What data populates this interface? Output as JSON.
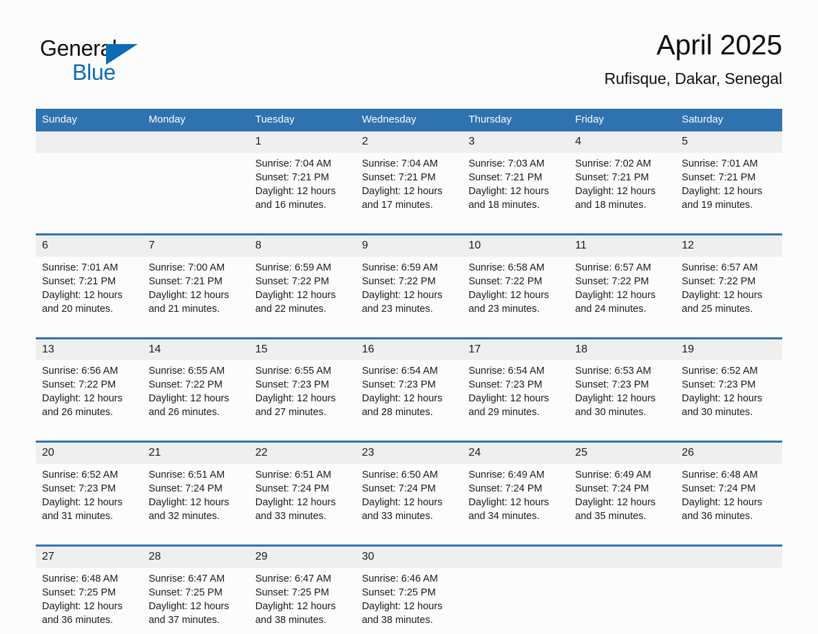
{
  "brand": {
    "word_one": "General",
    "word_two": "Blue",
    "triangle_icon": "triangle-icon"
  },
  "header": {
    "month_title": "April 2025",
    "location": "Rufisque, Dakar, Senegal"
  },
  "colors": {
    "header_blue": "#2f72b0",
    "brand_blue": "#0b6bb5",
    "daynum_band": "#efefef",
    "page_background": "#fcfcfd",
    "text": "#1a1a1a"
  },
  "calendar": {
    "weekdays": [
      "Sunday",
      "Monday",
      "Tuesday",
      "Wednesday",
      "Thursday",
      "Friday",
      "Saturday"
    ],
    "weeks": [
      [
        {
          "day": "",
          "lines": []
        },
        {
          "day": "",
          "lines": []
        },
        {
          "day": "1",
          "lines": [
            "Sunrise: 7:04 AM",
            "Sunset: 7:21 PM",
            "Daylight: 12 hours",
            "and 16 minutes."
          ]
        },
        {
          "day": "2",
          "lines": [
            "Sunrise: 7:04 AM",
            "Sunset: 7:21 PM",
            "Daylight: 12 hours",
            "and 17 minutes."
          ]
        },
        {
          "day": "3",
          "lines": [
            "Sunrise: 7:03 AM",
            "Sunset: 7:21 PM",
            "Daylight: 12 hours",
            "and 18 minutes."
          ]
        },
        {
          "day": "4",
          "lines": [
            "Sunrise: 7:02 AM",
            "Sunset: 7:21 PM",
            "Daylight: 12 hours",
            "and 18 minutes."
          ]
        },
        {
          "day": "5",
          "lines": [
            "Sunrise: 7:01 AM",
            "Sunset: 7:21 PM",
            "Daylight: 12 hours",
            "and 19 minutes."
          ]
        }
      ],
      [
        {
          "day": "6",
          "lines": [
            "Sunrise: 7:01 AM",
            "Sunset: 7:21 PM",
            "Daylight: 12 hours",
            "and 20 minutes."
          ]
        },
        {
          "day": "7",
          "lines": [
            "Sunrise: 7:00 AM",
            "Sunset: 7:21 PM",
            "Daylight: 12 hours",
            "and 21 minutes."
          ]
        },
        {
          "day": "8",
          "lines": [
            "Sunrise: 6:59 AM",
            "Sunset: 7:22 PM",
            "Daylight: 12 hours",
            "and 22 minutes."
          ]
        },
        {
          "day": "9",
          "lines": [
            "Sunrise: 6:59 AM",
            "Sunset: 7:22 PM",
            "Daylight: 12 hours",
            "and 23 minutes."
          ]
        },
        {
          "day": "10",
          "lines": [
            "Sunrise: 6:58 AM",
            "Sunset: 7:22 PM",
            "Daylight: 12 hours",
            "and 23 minutes."
          ]
        },
        {
          "day": "11",
          "lines": [
            "Sunrise: 6:57 AM",
            "Sunset: 7:22 PM",
            "Daylight: 12 hours",
            "and 24 minutes."
          ]
        },
        {
          "day": "12",
          "lines": [
            "Sunrise: 6:57 AM",
            "Sunset: 7:22 PM",
            "Daylight: 12 hours",
            "and 25 minutes."
          ]
        }
      ],
      [
        {
          "day": "13",
          "lines": [
            "Sunrise: 6:56 AM",
            "Sunset: 7:22 PM",
            "Daylight: 12 hours",
            "and 26 minutes."
          ]
        },
        {
          "day": "14",
          "lines": [
            "Sunrise: 6:55 AM",
            "Sunset: 7:22 PM",
            "Daylight: 12 hours",
            "and 26 minutes."
          ]
        },
        {
          "day": "15",
          "lines": [
            "Sunrise: 6:55 AM",
            "Sunset: 7:23 PM",
            "Daylight: 12 hours",
            "and 27 minutes."
          ]
        },
        {
          "day": "16",
          "lines": [
            "Sunrise: 6:54 AM",
            "Sunset: 7:23 PM",
            "Daylight: 12 hours",
            "and 28 minutes."
          ]
        },
        {
          "day": "17",
          "lines": [
            "Sunrise: 6:54 AM",
            "Sunset: 7:23 PM",
            "Daylight: 12 hours",
            "and 29 minutes."
          ]
        },
        {
          "day": "18",
          "lines": [
            "Sunrise: 6:53 AM",
            "Sunset: 7:23 PM",
            "Daylight: 12 hours",
            "and 30 minutes."
          ]
        },
        {
          "day": "19",
          "lines": [
            "Sunrise: 6:52 AM",
            "Sunset: 7:23 PM",
            "Daylight: 12 hours",
            "and 30 minutes."
          ]
        }
      ],
      [
        {
          "day": "20",
          "lines": [
            "Sunrise: 6:52 AM",
            "Sunset: 7:23 PM",
            "Daylight: 12 hours",
            "and 31 minutes."
          ]
        },
        {
          "day": "21",
          "lines": [
            "Sunrise: 6:51 AM",
            "Sunset: 7:24 PM",
            "Daylight: 12 hours",
            "and 32 minutes."
          ]
        },
        {
          "day": "22",
          "lines": [
            "Sunrise: 6:51 AM",
            "Sunset: 7:24 PM",
            "Daylight: 12 hours",
            "and 33 minutes."
          ]
        },
        {
          "day": "23",
          "lines": [
            "Sunrise: 6:50 AM",
            "Sunset: 7:24 PM",
            "Daylight: 12 hours",
            "and 33 minutes."
          ]
        },
        {
          "day": "24",
          "lines": [
            "Sunrise: 6:49 AM",
            "Sunset: 7:24 PM",
            "Daylight: 12 hours",
            "and 34 minutes."
          ]
        },
        {
          "day": "25",
          "lines": [
            "Sunrise: 6:49 AM",
            "Sunset: 7:24 PM",
            "Daylight: 12 hours",
            "and 35 minutes."
          ]
        },
        {
          "day": "26",
          "lines": [
            "Sunrise: 6:48 AM",
            "Sunset: 7:24 PM",
            "Daylight: 12 hours",
            "and 36 minutes."
          ]
        }
      ],
      [
        {
          "day": "27",
          "lines": [
            "Sunrise: 6:48 AM",
            "Sunset: 7:25 PM",
            "Daylight: 12 hours",
            "and 36 minutes."
          ]
        },
        {
          "day": "28",
          "lines": [
            "Sunrise: 6:47 AM",
            "Sunset: 7:25 PM",
            "Daylight: 12 hours",
            "and 37 minutes."
          ]
        },
        {
          "day": "29",
          "lines": [
            "Sunrise: 6:47 AM",
            "Sunset: 7:25 PM",
            "Daylight: 12 hours",
            "and 38 minutes."
          ]
        },
        {
          "day": "30",
          "lines": [
            "Sunrise: 6:46 AM",
            "Sunset: 7:25 PM",
            "Daylight: 12 hours",
            "and 38 minutes."
          ]
        },
        {
          "day": "",
          "lines": []
        },
        {
          "day": "",
          "lines": []
        },
        {
          "day": "",
          "lines": []
        }
      ]
    ]
  }
}
